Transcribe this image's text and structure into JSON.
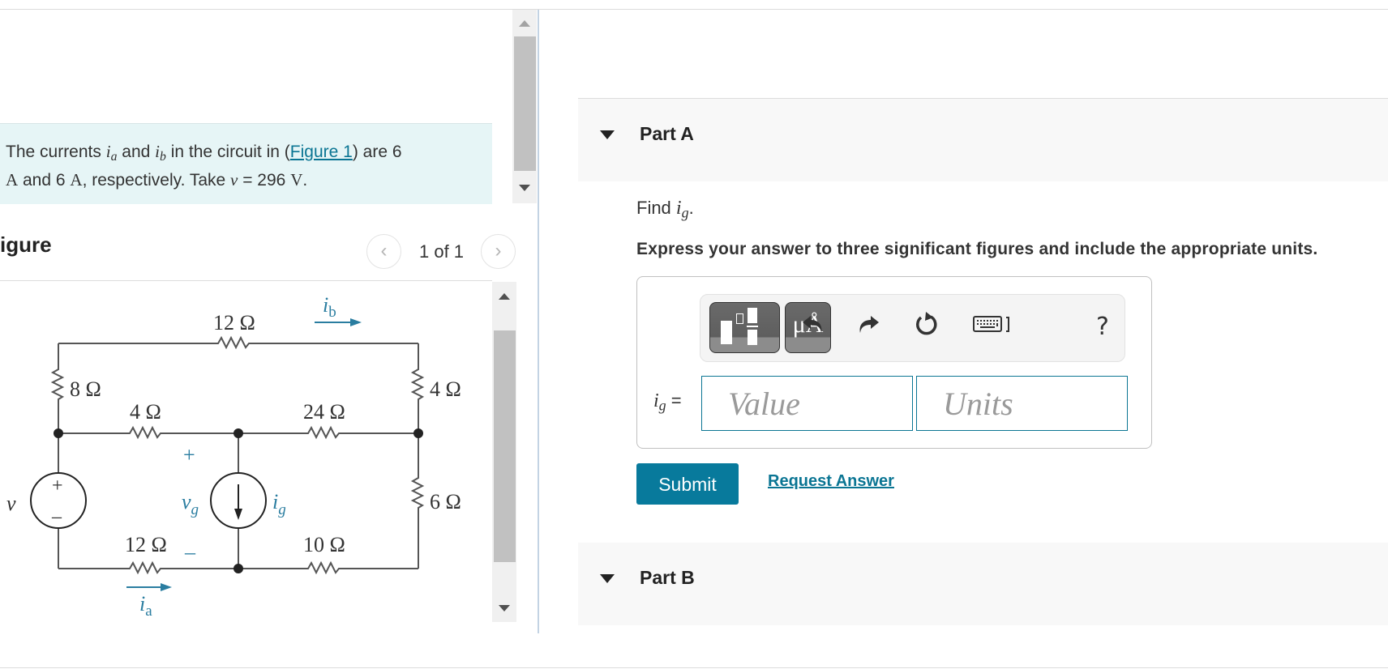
{
  "problem": {
    "text_parts": {
      "p1": "The currents ",
      "ia": "i",
      "ia_sub": "a",
      "p2": " and ",
      "ib": "i",
      "ib_sub": "b",
      "p3": " in the circuit in (",
      "link": "Figure 1",
      "p4": ") are 6",
      "unitA1": "A",
      "p5": " and 6 ",
      "unitA2": "A",
      "p6": ", respectively. Take ",
      "v": "v",
      "p7": " = 296 ",
      "unitV": "V",
      "p8": "."
    }
  },
  "figure": {
    "title": "igure",
    "pager": {
      "label": "1 of 1",
      "prev_icon": "chevron-left-icon",
      "next_icon": "chevron-right-icon"
    },
    "circuit": {
      "resistors": {
        "r_top": "12 Ω",
        "r_left": "8 Ω",
        "r_mid_left": "4 Ω",
        "r_mid_right": "24 Ω",
        "r_right_top": "4 Ω",
        "r_right_bottom": "6 Ω",
        "r_bottom_left": "12 Ω",
        "r_bottom_right": "10 Ω"
      },
      "labels": {
        "v": "v",
        "vg": "v",
        "vg_sub": "g",
        "ig": "i",
        "ig_sub": "g",
        "ia": "i",
        "ia_sub": "a",
        "ib": "i",
        "ib_sub": "b",
        "plus": "+",
        "minus": "–"
      },
      "accent_color": "#2a7da0"
    }
  },
  "partA": {
    "title": "Part A",
    "find_prefix": "Find ",
    "find_var": "i",
    "find_sub": "g",
    "find_suffix": ".",
    "instructions": "Express your answer to three significant figures and include the appropriate units.",
    "toolbar": {
      "templates_icon": "templates-icon",
      "units_button": "μÅ",
      "undo_icon": "undo-icon",
      "redo_icon": "redo-icon",
      "reset_icon": "reset-icon",
      "keyboard_icon": "keyboard-icon",
      "help": "?"
    },
    "answer_label_var": "i",
    "answer_label_sub": "g",
    "answer_label_eq": " =",
    "value_placeholder": "Value",
    "units_placeholder": "Units",
    "submit": "Submit",
    "request_answer": "Request Answer"
  },
  "partB": {
    "title": "Part B"
  },
  "colors": {
    "accent": "#087a9c",
    "link": "#0a7593",
    "problem_bg": "#e6f5f6"
  }
}
